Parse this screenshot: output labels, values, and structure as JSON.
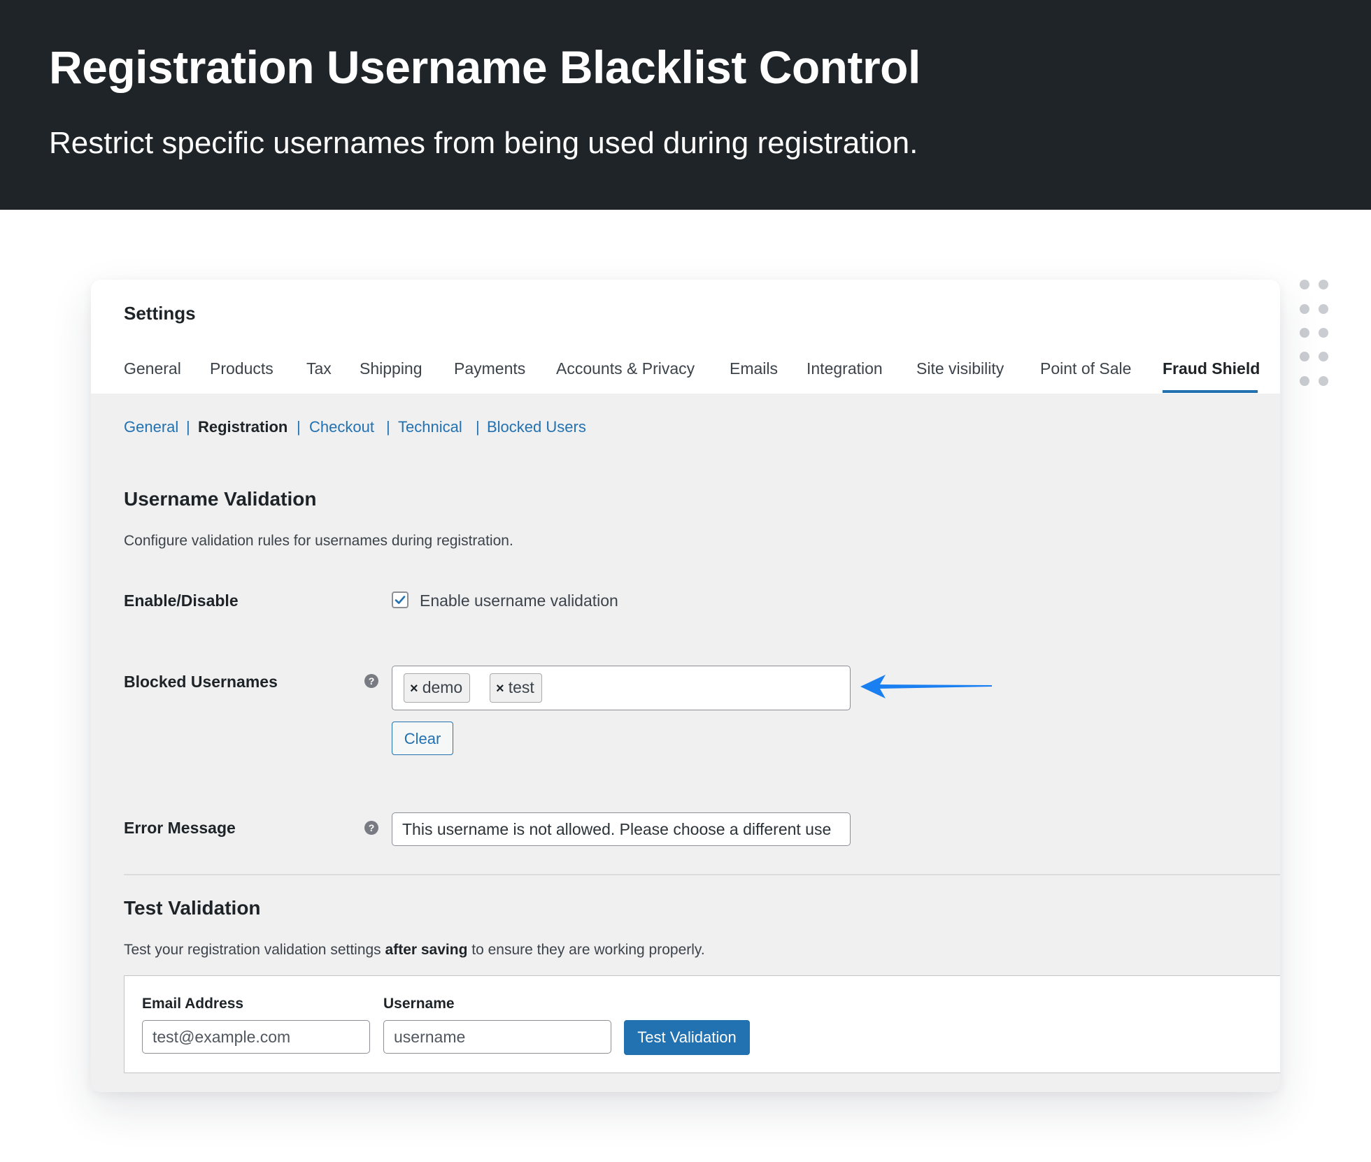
{
  "hero": {
    "title": "Registration Username Blacklist Control",
    "subtitle": "Restrict specific usernames from being used during registration."
  },
  "settings": {
    "title": "Settings",
    "tabs": [
      {
        "label": "General"
      },
      {
        "label": "Products"
      },
      {
        "label": "Tax"
      },
      {
        "label": "Shipping"
      },
      {
        "label": "Payments"
      },
      {
        "label": "Accounts & Privacy"
      },
      {
        "label": "Emails"
      },
      {
        "label": "Integration"
      },
      {
        "label": "Site visibility"
      },
      {
        "label": "Point of Sale"
      },
      {
        "label": "Fraud Shield",
        "active": true
      }
    ],
    "subnav": {
      "general": "General",
      "registration": "Registration",
      "checkout": "Checkout",
      "technical": "Technical",
      "blocked_users": "Blocked Users",
      "separator": "|"
    }
  },
  "username_validation": {
    "heading": "Username Validation",
    "description": "Configure validation rules for usernames during registration.",
    "enable": {
      "label": "Enable/Disable",
      "checkbox_label": "Enable username validation",
      "checked": true
    },
    "blocked": {
      "label": "Blocked Usernames",
      "tags": [
        "demo",
        "test"
      ],
      "tag_remove_glyph": "×",
      "clear_button": "Clear"
    },
    "error_message": {
      "label": "Error Message",
      "value": "This username is not allowed. Please choose a different use"
    },
    "help_glyph": "?"
  },
  "test_validation": {
    "heading": "Test Validation",
    "description_pre": "Test your registration validation settings ",
    "description_bold": "after saving",
    "description_post": " to ensure they are working properly.",
    "email": {
      "label": "Email Address",
      "placeholder": "test@example.com"
    },
    "username": {
      "label": "Username",
      "placeholder": "username"
    },
    "button": "Test Validation"
  },
  "colors": {
    "hero_bg": "#1f2428",
    "accent": "#2271b1",
    "arrow": "#1a7ff0"
  },
  "icons": {
    "help": "help-circle-icon",
    "check": "checkmark-icon",
    "arrow": "left-arrow-icon",
    "dots": "dot-grid-icon"
  }
}
